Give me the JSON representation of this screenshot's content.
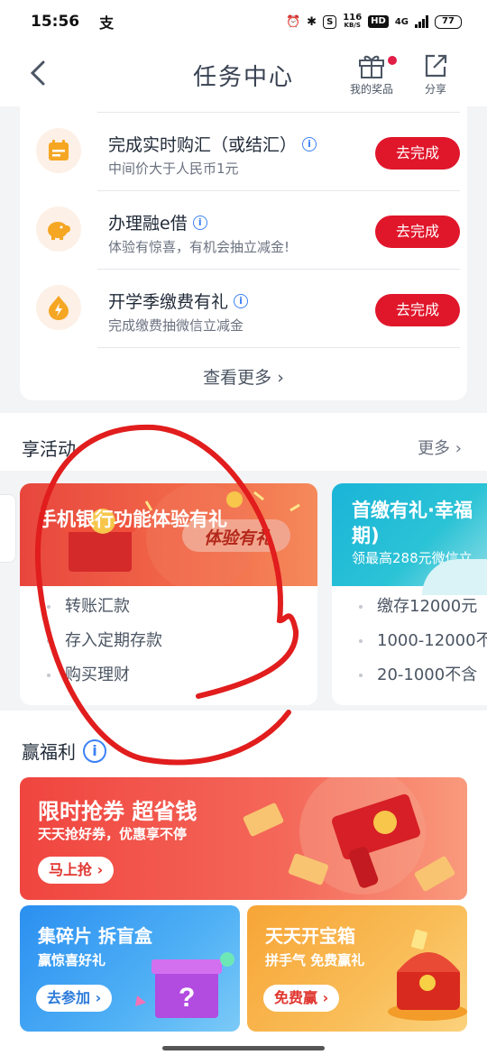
{
  "status": {
    "time": "15:56",
    "net_speed_value": "116",
    "net_speed_unit": "KB/S",
    "hd": "HD",
    "network": "4G",
    "battery": "77"
  },
  "nav": {
    "title": "任务中心",
    "prize_label": "我的奖品",
    "share_label": "分享"
  },
  "tasks": [
    {
      "title": "完成实时购汇（或结汇）",
      "desc": "中间价大于人民币1元",
      "button": "去完成",
      "icon": "calendar-icon"
    },
    {
      "title": "办理融e借",
      "desc": "体验有惊喜，有机会抽立减金!",
      "button": "去完成",
      "icon": "piggy-bank-icon"
    },
    {
      "title": "开学季缴费有礼",
      "desc": "完成缴费抽微信立减金",
      "button": "去完成",
      "icon": "flash-coin-icon"
    }
  ],
  "more_tasks": "查看更多",
  "activities": {
    "heading": "享活动",
    "more": "更多",
    "cards": [
      {
        "title": "手机银行功能体验有礼",
        "badge": "体验有礼",
        "items": [
          "转账汇款",
          "存入定期存款",
          "购买理财"
        ]
      },
      {
        "title": "首缴有礼·幸福",
        "title2": "期)",
        "sub": "领最高288元微信立",
        "items": [
          "缴存12000元",
          "1000-12000不",
          "20-1000不含"
        ]
      }
    ]
  },
  "welfare": {
    "heading": "赢福利",
    "big": {
      "title": "限时抢券 超省钱",
      "sub": "天天抢好券，优惠享不停",
      "button": "马上抢"
    },
    "left": {
      "title": "集碎片 拆盲盒",
      "sub": "赢惊喜好礼",
      "button": "去参加"
    },
    "right": {
      "title": "天天开宝箱",
      "sub": "拼手气 免费赢礼",
      "button": "免费赢"
    }
  }
}
